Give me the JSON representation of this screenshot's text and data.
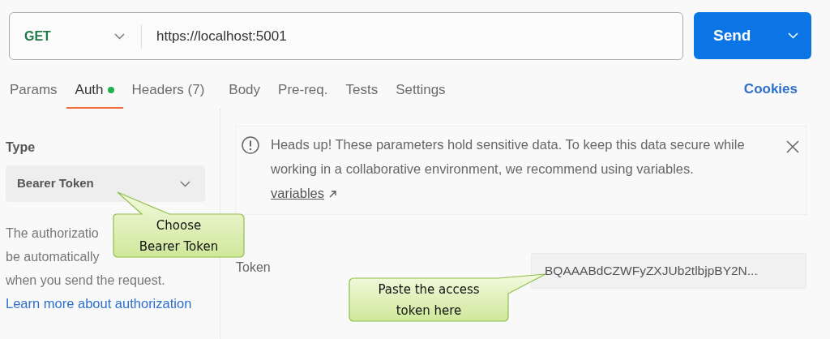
{
  "request": {
    "method": "GET",
    "url": "https://localhost:5001",
    "send_label": "Send"
  },
  "tabs": [
    {
      "label": "Params",
      "selected": false,
      "dot": false
    },
    {
      "label": "Auth",
      "selected": true,
      "dot": true
    },
    {
      "label": "Headers (7)",
      "selected": false,
      "dot": false
    },
    {
      "label": "Body",
      "selected": false,
      "dot": false
    },
    {
      "label": "Pre-req.",
      "selected": false,
      "dot": false
    },
    {
      "label": "Tests",
      "selected": false,
      "dot": false
    },
    {
      "label": "Settings",
      "selected": false,
      "dot": false
    }
  ],
  "cookies_link": "Cookies",
  "auth": {
    "type_label": "Type",
    "type_value": "Bearer Token",
    "description_lines": [
      "The authorizatio",
      "be automatically",
      "when you send the request."
    ],
    "learn_more": "Learn more about authorization"
  },
  "alert": {
    "text": "Heads up! These parameters hold sensitive data. To keep this data secure while working in a collaborative environment, we recommend using variables.",
    "link": "variables"
  },
  "token": {
    "label": "Token",
    "value": "BQAAABdCZWFyZXJUb2tlbjpBY2N..."
  },
  "callouts": [
    {
      "text": "Choose Bearer Token"
    },
    {
      "text": "Paste the access token here"
    }
  ]
}
